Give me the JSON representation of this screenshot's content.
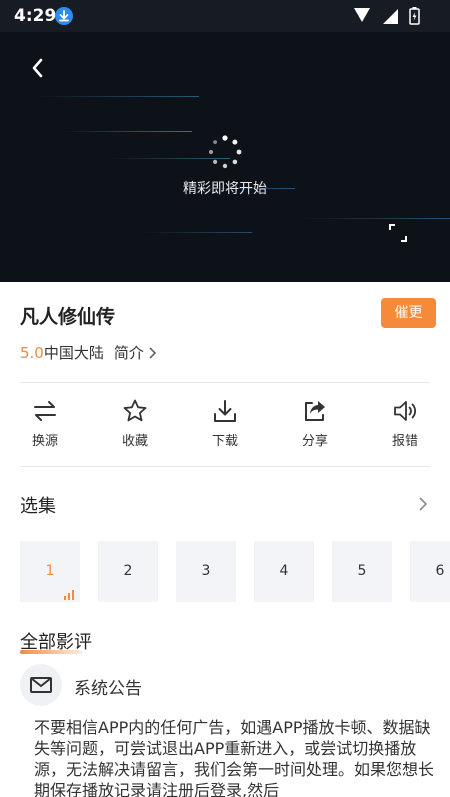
{
  "status_bar": {
    "time": "4:29"
  },
  "player": {
    "loading_text": "精彩即将开始"
  },
  "show": {
    "title": "凡人修仙传",
    "urge_label": "催更",
    "rating": "5.0",
    "region": "中国大陆",
    "intro_label": "简介"
  },
  "actions": [
    {
      "label": "换源",
      "icon": "swap-icon"
    },
    {
      "label": "收藏",
      "icon": "star-icon"
    },
    {
      "label": "下载",
      "icon": "download-icon"
    },
    {
      "label": "分享",
      "icon": "share-icon"
    },
    {
      "label": "报错",
      "icon": "speaker-icon"
    }
  ],
  "episodes": {
    "title": "选集",
    "items": [
      "1",
      "2",
      "3",
      "4",
      "5",
      "6"
    ],
    "active_index": 0
  },
  "reviews": {
    "title": "全部影评",
    "notice_title": "系统公告",
    "notice_text": "不要相信APP内的任何广告，如遇APP播放卡顿、数据缺失等问题，可尝试退出APP重新进入，或尝试切换播放源，无法解决请留言，我们会第一时间处理。如果您想长期保存播放记录请注册后登录,然后"
  },
  "colors": {
    "accent": "#f48a3a",
    "player_bg": "#0d1219",
    "status_bg": "#161b24"
  }
}
